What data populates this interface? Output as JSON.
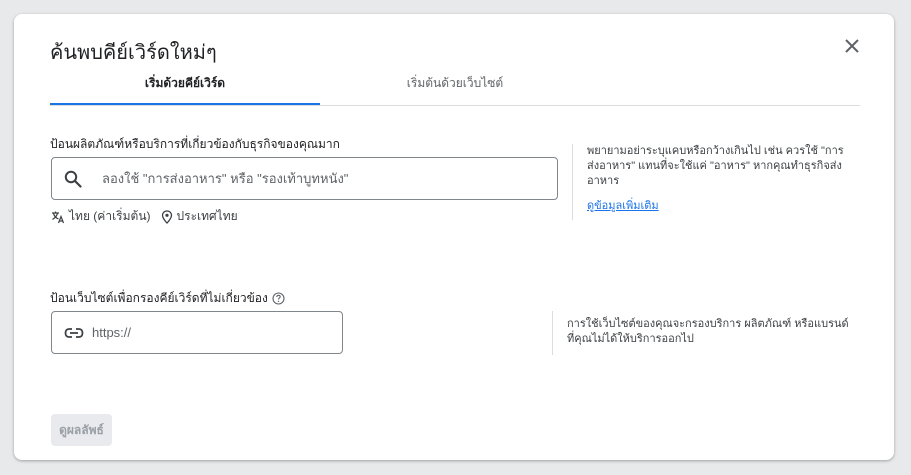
{
  "dialog": {
    "title": "ค้นพบคีย์เวิร์ดใหม่ๆ",
    "close_icon": "close-icon"
  },
  "tabs": [
    {
      "label": "เริ่มด้วยคีย์เวิร์ด",
      "active": true
    },
    {
      "label": "เริ่มต้นด้วยเว็บไซต์",
      "active": false
    }
  ],
  "keywords": {
    "label": "ป้อนผลิตภัณฑ์หรือบริการที่เกี่ยวข้องกับธุรกิจของคุณมาก",
    "placeholder": "ลองใช้ \"การส่งอาหาร\" หรือ \"รองเท้าบูทหนัง\"",
    "value": "",
    "language": "ไทย (ค่าเริ่มต้น)",
    "location": "ประเทศไทย",
    "help_text": "พยายามอย่าระบุแคบหรือกว้างเกินไป เช่น ควรใช้ \"การส่งอาหาร\" แทนที่จะใช้แค่ \"อาหาร\" หากคุณทำธุรกิจส่งอาหาร",
    "help_link": "ดูข้อมูลเพิ่มเติม"
  },
  "website": {
    "label": "ป้อนเว็บไซต์เพื่อกรองคีย์เวิร์ดที่ไม่เกี่ยวข้อง",
    "placeholder": "https://",
    "value": "",
    "help_text": "การใช้เว็บไซต์ของคุณจะกรองบริการ ผลิตภัณฑ์ หรือแบรนด์ที่คุณไม่ได้ให้บริการออกไป"
  },
  "actions": {
    "submit_label": "ดูผลลัพธ์",
    "submit_enabled": false
  },
  "colors": {
    "accent": "#1a73e8",
    "border": "#80868b",
    "divider": "#dadce0",
    "disabled_bg": "#e8eaed",
    "disabled_text": "#9aa0a6"
  }
}
